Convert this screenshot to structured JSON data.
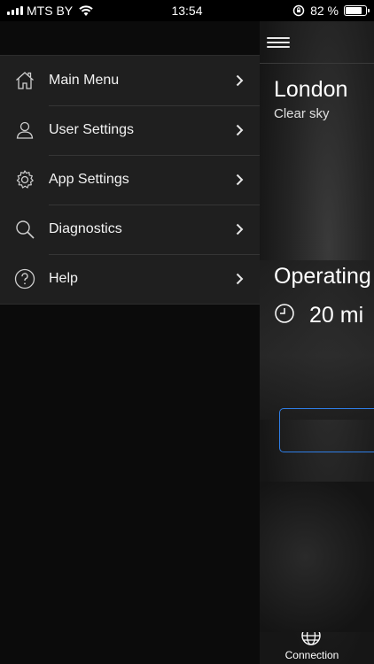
{
  "status_bar": {
    "carrier": "MTS BY",
    "time": "13:54",
    "battery": "82 %",
    "battery_level": 0.82
  },
  "drawer": {
    "items": [
      {
        "label": "Main Menu",
        "icon": "home-icon"
      },
      {
        "label": "User Settings",
        "icon": "user-icon"
      },
      {
        "label": "App Settings",
        "icon": "gear-icon"
      },
      {
        "label": "Diagnostics",
        "icon": "search-icon"
      },
      {
        "label": "Help",
        "icon": "help-icon"
      }
    ]
  },
  "main": {
    "city": "London",
    "weather": "Clear sky",
    "operating": "Operating",
    "duration": "20 mi",
    "bottom_nav": {
      "label": "Connection",
      "icon": "globe-icon"
    }
  },
  "colors": {
    "accent_blue": "#2f7ee6",
    "drawer_bg": "#1f1f1f"
  }
}
